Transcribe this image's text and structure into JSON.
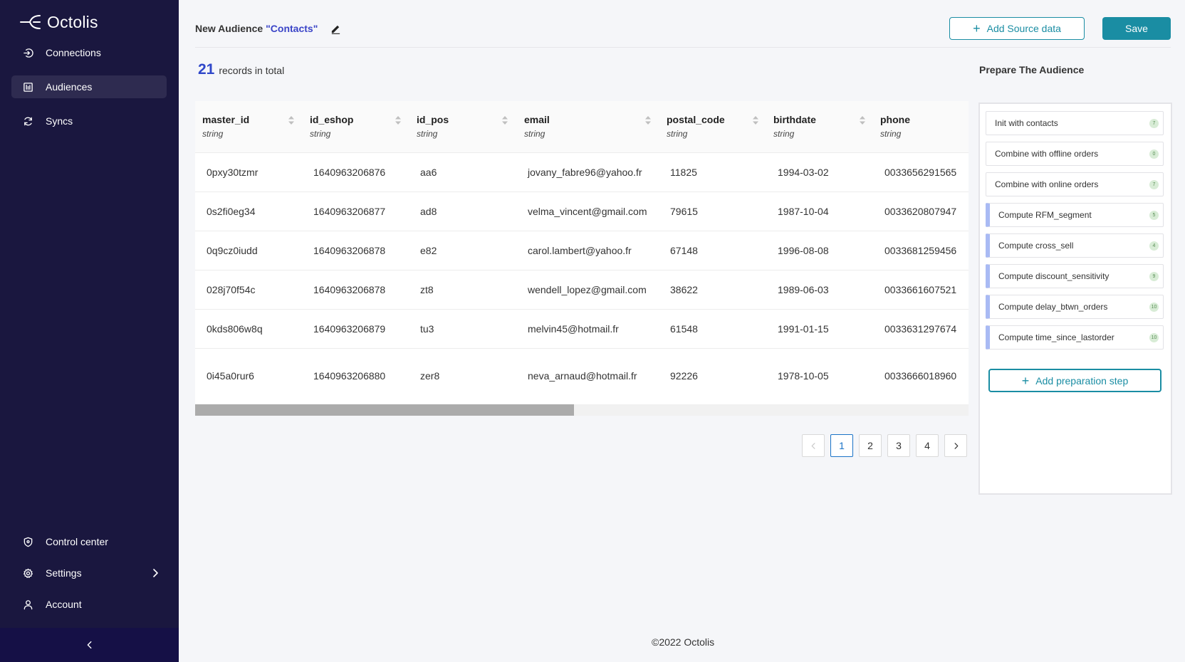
{
  "app": {
    "name": "Octolis",
    "logo_icon": "octolis-logo-icon"
  },
  "sidebar": {
    "top_items": [
      {
        "label": "Connections",
        "icon": "connections-icon"
      },
      {
        "label": "Audiences",
        "icon": "audiences-icon",
        "active": true
      },
      {
        "label": "Syncs",
        "icon": "sync-icon"
      }
    ],
    "bottom_items": [
      {
        "label": "Control center",
        "icon": "shield-icon"
      },
      {
        "label": "Settings",
        "icon": "gear-icon"
      },
      {
        "label": "Account",
        "icon": "user-icon"
      }
    ],
    "collapse_icon": "chevron-left-icon"
  },
  "header": {
    "prefix": "New Audience",
    "audience_name": "\"Contacts\"",
    "add_source_label": "Add Source data",
    "save_label": "Save"
  },
  "records": {
    "count": "21",
    "label": "records in total"
  },
  "table": {
    "columns": [
      {
        "name": "master_id",
        "type": "string"
      },
      {
        "name": "id_eshop",
        "type": "string"
      },
      {
        "name": "id_pos",
        "type": "string"
      },
      {
        "name": "email",
        "type": "string"
      },
      {
        "name": "postal_code",
        "type": "string"
      },
      {
        "name": "birthdate",
        "type": "string"
      },
      {
        "name": "phone",
        "type": "string"
      }
    ],
    "rows": [
      [
        "0pxy30tzmr",
        "1640963206876",
        "aa6",
        "jovany_fabre96@yahoo.fr",
        "11825",
        "1994-03-02",
        "0033656291565"
      ],
      [
        "0s2fi0eg34",
        "1640963206877",
        "ad8",
        "velma_vincent@gmail.com",
        "79615",
        "1987-10-04",
        "0033620807947"
      ],
      [
        "0q9cz0iudd",
        "1640963206878",
        "e82",
        "carol.lambert@yahoo.fr",
        "67148",
        "1996-08-08",
        "0033681259456"
      ],
      [
        "028j70f54c",
        "1640963206878",
        "zt8",
        "wendell_lopez@gmail.com",
        "38622",
        "1989-06-03",
        "0033661607521"
      ],
      [
        "0kds806w8q",
        "1640963206879",
        "tu3",
        "melvin45@hotmail.fr",
        "61548",
        "1991-01-15",
        "0033631297674"
      ],
      [
        "0i45a0rur6",
        "1640963206880",
        "zer8",
        "neva_arnaud@hotmail.fr",
        "92226",
        "1978-10-05",
        "0033666018960"
      ]
    ],
    "scroll_fraction": 0.49
  },
  "pagination": {
    "pages": [
      "1",
      "2",
      "3",
      "4"
    ],
    "current": "1",
    "prev_icon": "chevron-left-icon",
    "next_icon": "chevron-right-icon"
  },
  "prepare": {
    "title": "Prepare The Audience",
    "steps": [
      {
        "label": "Init with contacts",
        "badge": "7",
        "sub": false
      },
      {
        "label": "Combine with offline orders",
        "badge": "0",
        "sub": false
      },
      {
        "label": "Combine with online orders",
        "badge": "7",
        "sub": false
      },
      {
        "label": "Compute RFM_segment",
        "badge": "5",
        "sub": true
      },
      {
        "label": "Compute cross_sell",
        "badge": "4",
        "sub": true
      },
      {
        "label": "Compute discount_sensitivity",
        "badge": "9",
        "sub": true
      },
      {
        "label": "Compute delay_btwn_orders",
        "badge": "10",
        "sub": true
      },
      {
        "label": "Compute time_since_lastorder",
        "badge": "10",
        "sub": true
      }
    ],
    "add_step_label": "Add preparation step"
  },
  "footer": {
    "text": "©2022 Octolis"
  },
  "colors": {
    "sidebar_bg": "#1a173f",
    "accent": "#1a8da3",
    "count_blue": "#2f47c9"
  }
}
